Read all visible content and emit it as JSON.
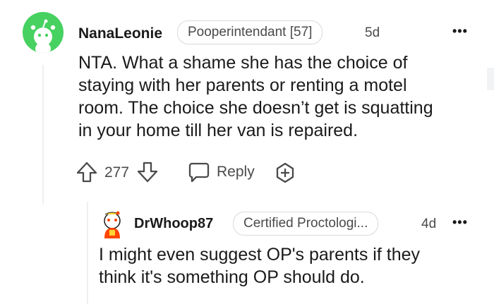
{
  "comment": {
    "username": "NanaLeonie",
    "flair": "Pooperintendant [57]",
    "age": "5d",
    "more": "•••",
    "body_lines": [
      "NTA. What a shame she has the choice of",
      "staying with her parents or renting a motel",
      "room. The choice she doesn’t get is squatting",
      "in your home till her van is repaired."
    ],
    "score": "277",
    "reply_label": "Reply"
  },
  "reply": {
    "username": "DrWhoop87",
    "flair": "Certified Proctologi...",
    "age": "4d",
    "more": "•••",
    "body_lines": [
      "I might even suggest OP's parents if they",
      "think it's something OP should do."
    ]
  },
  "colors": {
    "avatar_main_bg": "#46d160",
    "snoo_white": "#ffffff",
    "reply_avatar_red": "#ff4500",
    "reply_avatar_yellow": "#ffd635",
    "text": "#1a1a1b",
    "muted": "#4a4a4a",
    "border": "#d7dadc"
  },
  "icons": {
    "avatar_main": "snoo-avatar-icon",
    "avatar_reply": "snoo-avatar-icon",
    "upvote": "upvote-arrow-icon",
    "downvote": "downvote-arrow-icon",
    "reply": "speech-bubble-icon",
    "award": "add-award-icon",
    "more": "more-options-icon"
  }
}
